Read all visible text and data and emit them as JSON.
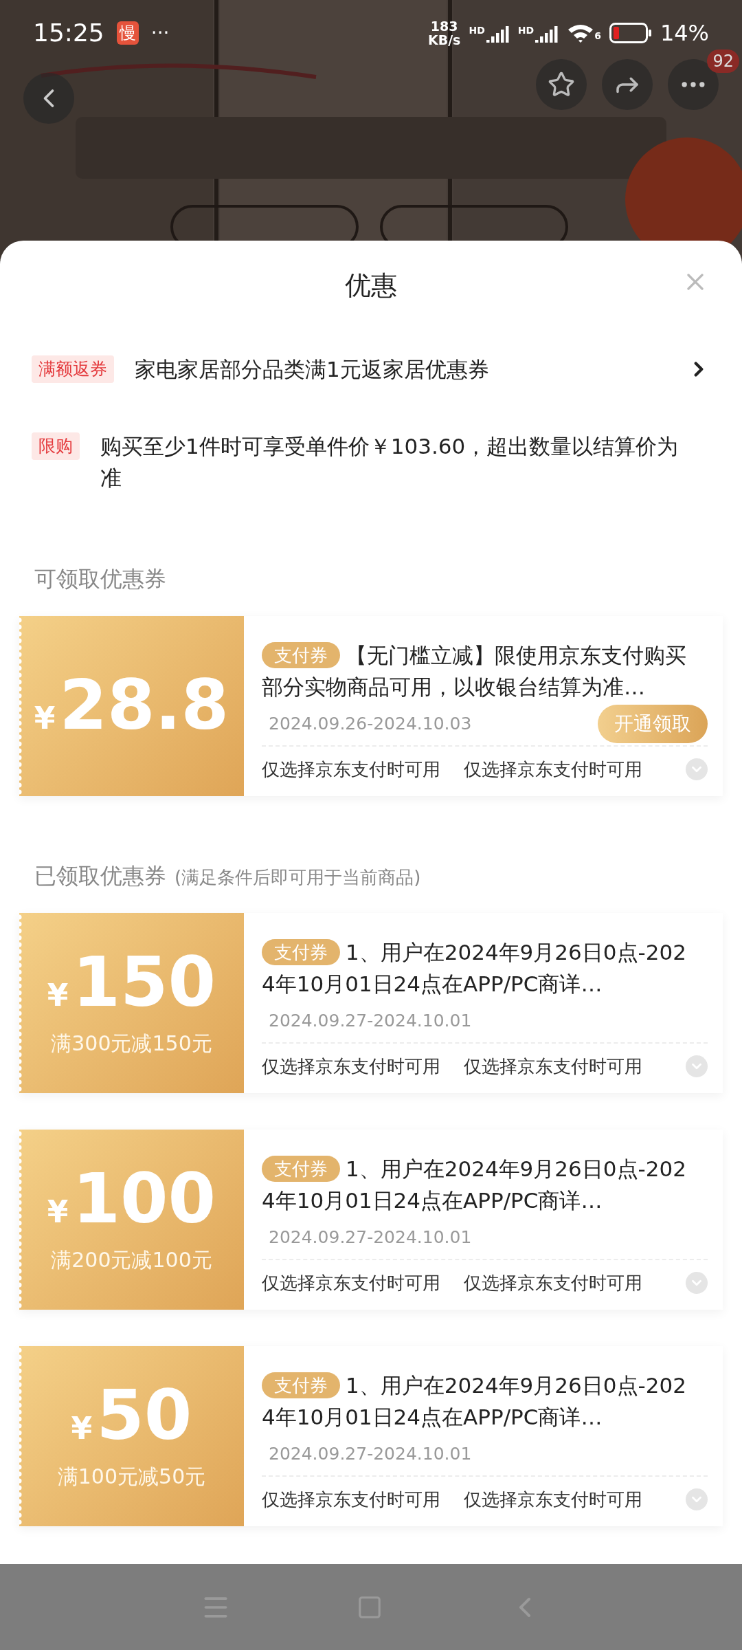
{
  "status_bar": {
    "time": "15:25",
    "app_badge": "慢",
    "more": "···",
    "net_speed_value": "183",
    "net_speed_unit": "KB/s",
    "signal_labels": [
      "HD",
      "HD"
    ],
    "wifi_label": "6",
    "battery": "14%"
  },
  "top_bar": {
    "notification_count": "92"
  },
  "sheet": {
    "title": "优惠",
    "promos": [
      {
        "tag": "满额返券",
        "text": "家电家居部分品类满1元返家居优惠券",
        "has_arrow": true
      },
      {
        "tag": "限购",
        "text": "购买至少1件时可享受单件价￥103.60，超出数量以结算价为准",
        "has_arrow": false
      }
    ],
    "sections": [
      {
        "title": "可领取优惠券",
        "coupons": [
          {
            "currency": "¥",
            "amount": "28.8",
            "type_tag": "支付券",
            "description": "【无门槛立减】限使用京东支付购买部分实物商品可用，以收银台结算为准…",
            "validity": "2024.09.26-2024.10.03",
            "action": "开通领取",
            "notes": [
              "仅选择京东支付时可用",
              "仅选择京东支付时可用"
            ]
          }
        ]
      },
      {
        "title": "已领取优惠券",
        "subtitle": "(满足条件后即可用于当前商品)",
        "coupons": [
          {
            "currency": "¥",
            "amount": "150",
            "condition": "满300元减150元",
            "type_tag": "支付券",
            "description": "1、用户在2024年9月26日0点-2024年10月01日24点在APP/PC商详…",
            "validity": "2024.09.27-2024.10.01",
            "notes": [
              "仅选择京东支付时可用",
              "仅选择京东支付时可用"
            ]
          },
          {
            "currency": "¥",
            "amount": "100",
            "condition": "满200元减100元",
            "type_tag": "支付券",
            "description": "1、用户在2024年9月26日0点-2024年10月01日24点在APP/PC商详…",
            "validity": "2024.09.27-2024.10.01",
            "notes": [
              "仅选择京东支付时可用",
              "仅选择京东支付时可用"
            ]
          },
          {
            "currency": "¥",
            "amount": "50",
            "condition": "满100元减50元",
            "type_tag": "支付券",
            "description": "1、用户在2024年9月26日0点-2024年10月01日24点在APP/PC商详…",
            "validity": "2024.09.27-2024.10.01",
            "notes": [
              "仅选择京东支付时可用",
              "仅选择京东支付时可用"
            ]
          }
        ]
      }
    ]
  }
}
